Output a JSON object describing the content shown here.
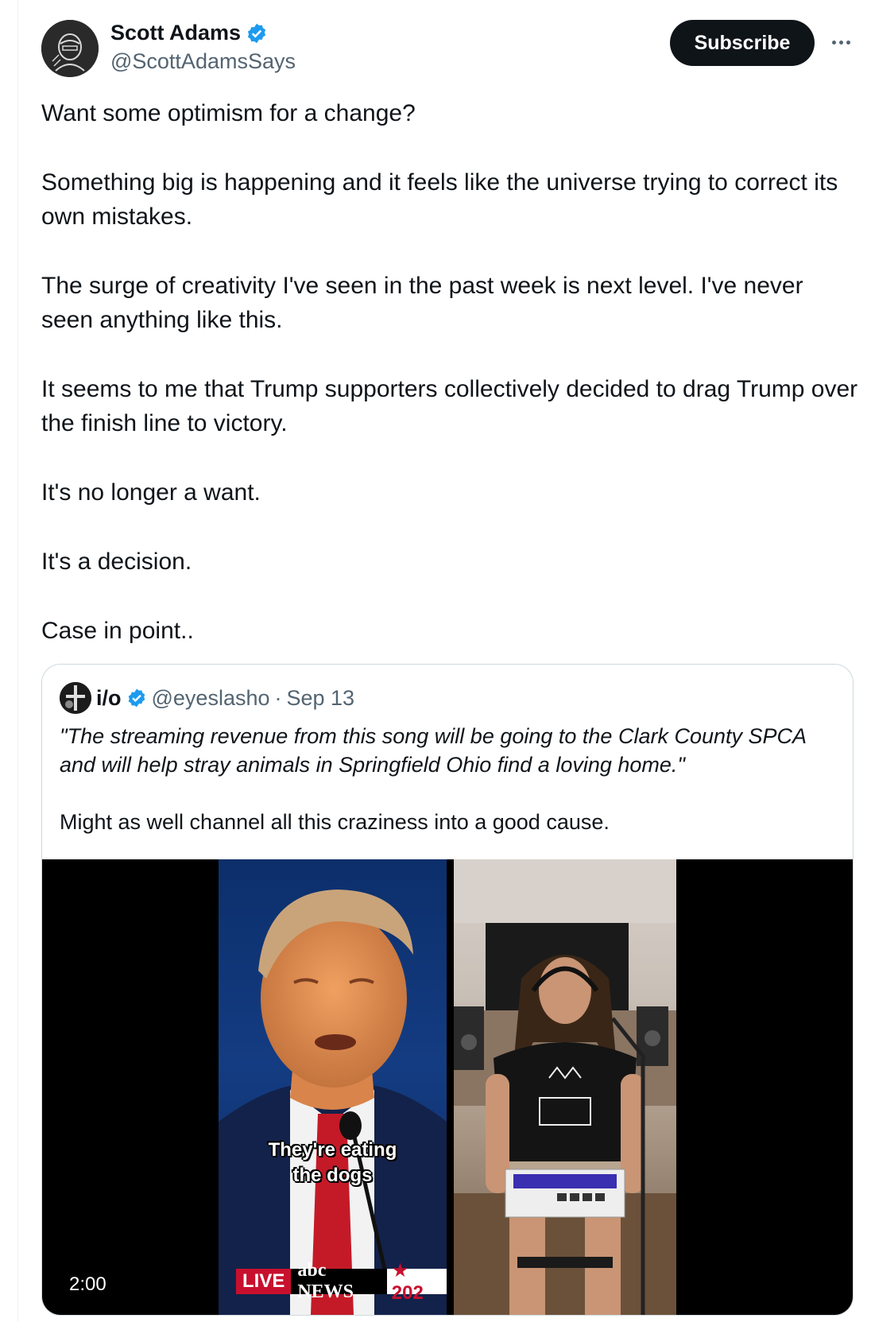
{
  "author": {
    "name": "Scott Adams",
    "handle": "@ScottAdamsSays"
  },
  "actions": {
    "subscribe_label": "Subscribe",
    "more_icon": "more-horizontal-icon"
  },
  "tweet": {
    "paragraphs": [
      "Want some optimism for a change?",
      "Something big is happening and it feels like the universe trying to correct its own mistakes.",
      "The surge of creativity I've seen in the past week is next level. I've never seen anything like this.",
      "It seems to me that Trump supporters collectively decided to drag Trump over the finish line to victory.",
      "It's no longer a want.",
      "It's a decision.",
      "Case in point.."
    ]
  },
  "quoted": {
    "name": "i/o",
    "handle": "@eyeslasho",
    "separator": "·",
    "date": "Sep 13",
    "quote": "\"The streaming revenue from this song will be going to the Clark County SPCA and will help stray animals in Springfield Ohio find a loving home.\"",
    "text": "Might as well channel all this craziness into a good cause.",
    "video": {
      "duration": "2:00",
      "caption_line1": "They're eating",
      "caption_line2": "the dogs",
      "live_label": "LIVE",
      "network_label": "abc NEWS",
      "year_label": "★ 202"
    }
  },
  "colors": {
    "verified": "#1d9bf0",
    "text": "#0f1419",
    "secondary": "#536471",
    "border": "#cfd9de"
  }
}
